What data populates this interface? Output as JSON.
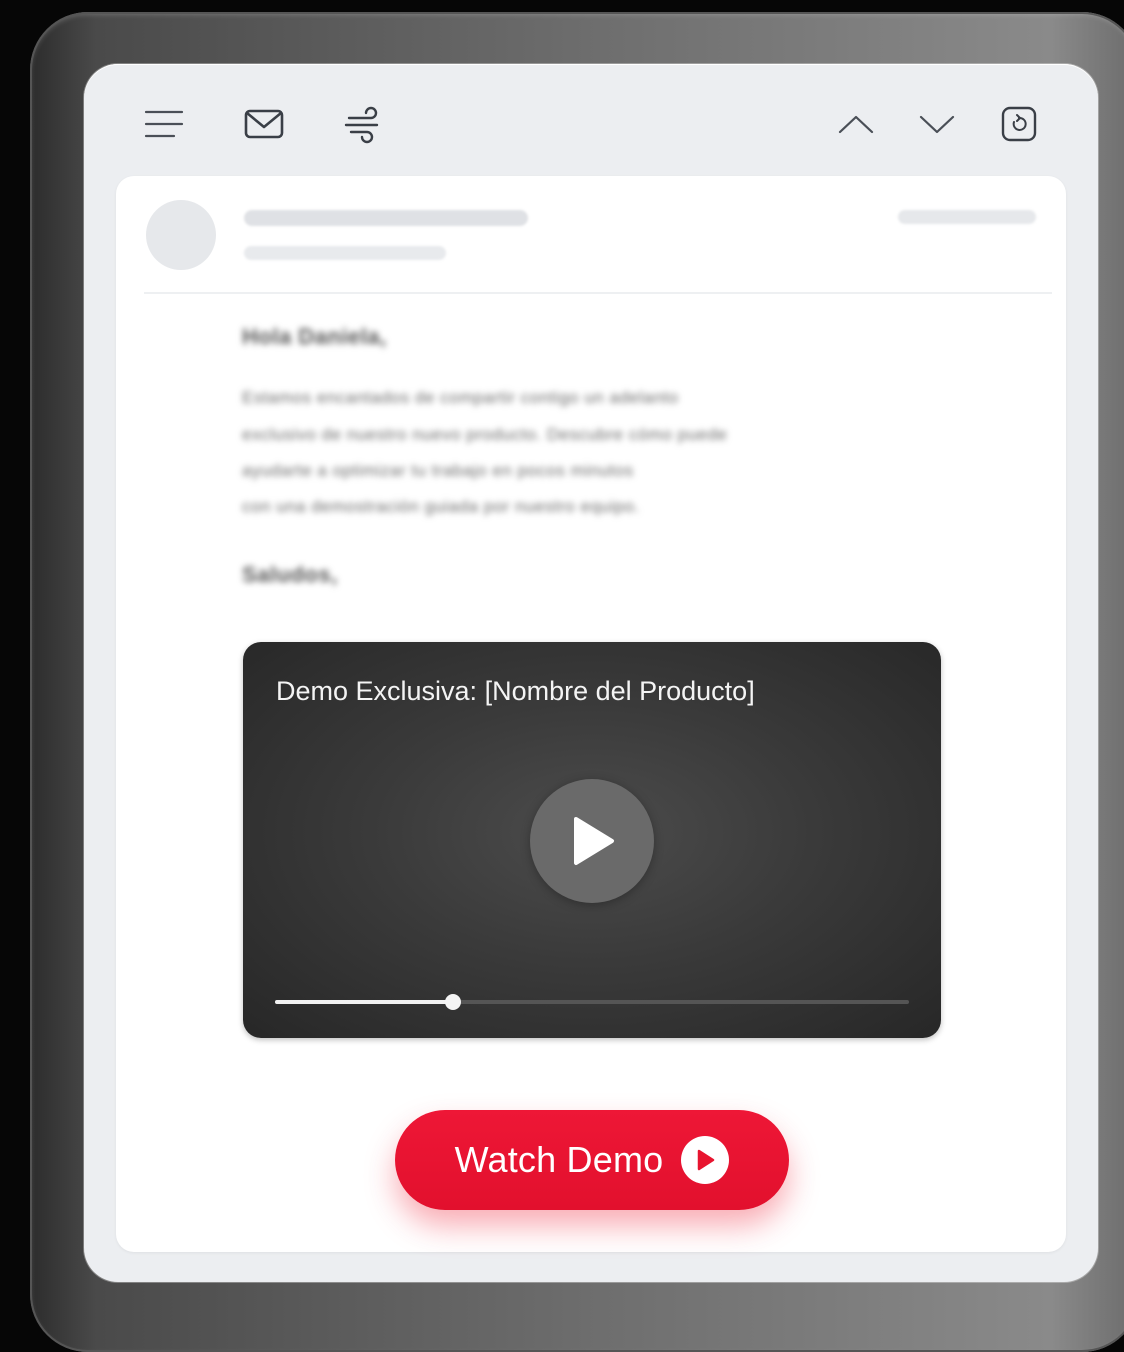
{
  "toolbar": {
    "left_icons": [
      "menu-icon",
      "mail-icon",
      "wind-icon"
    ],
    "right_icons": [
      "chevron-up-icon",
      "chevron-down-icon",
      "refresh-icon"
    ]
  },
  "email": {
    "greeting": "Hola Daniela,",
    "paragraph_lines": [
      "Estamos encantados de compartir contigo un adelanto",
      "exclusivo de nuestro nuevo producto. Descubre cómo puede",
      "ayudarte a optimizar tu trabajo en pocos minutos",
      "con una demostración guiada por nuestro equipo."
    ],
    "signoff": "Saludos,"
  },
  "video": {
    "title": "Demo Exclusiva: [Nombre del Producto]",
    "progress": 0.28
  },
  "cta": {
    "label": "Watch Demo"
  },
  "colors": {
    "accent": "#E8142F",
    "video_bg": "#2F2F2F",
    "screen_bg": "#ECEEF1"
  }
}
